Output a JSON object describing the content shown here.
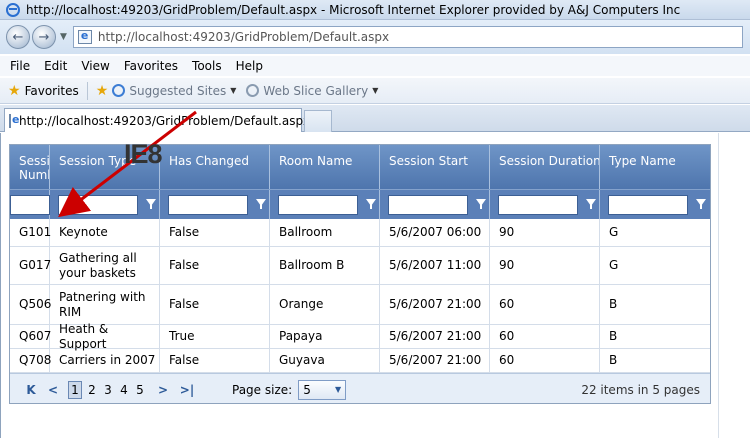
{
  "window": {
    "title": "http://localhost:49203/GridProblem/Default.aspx - Microsoft Internet Explorer provided by A&J Computers Inc"
  },
  "address_bar": {
    "url": "http://localhost:49203/GridProblem/Default.aspx"
  },
  "menu": {
    "items": [
      "File",
      "Edit",
      "View",
      "Favorites",
      "Tools",
      "Help"
    ]
  },
  "favorites_bar": {
    "favorites_label": "Favorites",
    "suggested_sites": "Suggested Sites",
    "web_slice_gallery": "Web Slice Gallery"
  },
  "tab": {
    "label": "http://localhost:49203/GridProblem/Default.aspx"
  },
  "grid": {
    "columns": [
      "Session Number",
      "Session Type",
      "Has Changed",
      "Room Name",
      "Session Start",
      "Session Duration",
      "Type Name"
    ],
    "rows": [
      [
        "G101",
        "Keynote",
        "False",
        "Ballroom",
        "5/6/2007 06:00",
        "90",
        "G"
      ],
      [
        "G017",
        "Gathering all your baskets",
        "False",
        "Ballroom B",
        "5/6/2007 11:00",
        "90",
        "G"
      ],
      [
        "Q506",
        "Patnering with RIM",
        "False",
        "Orange",
        "5/6/2007 21:00",
        "60",
        "B"
      ],
      [
        "Q607",
        "Heath & Support",
        "True",
        "Papaya",
        "5/6/2007 21:00",
        "60",
        "B"
      ],
      [
        "Q708",
        "Carriers in 2007",
        "False",
        "Guyava",
        "5/6/2007 21:00",
        "60",
        "B"
      ]
    ],
    "pager": {
      "first": "K",
      "prev": "<",
      "pages": [
        "1",
        "2",
        "3",
        "4",
        "5"
      ],
      "current_page": "1",
      "next": ">",
      "last": ">|",
      "page_size_label": "Page size:",
      "page_size_value": "5",
      "items_info": "22 items in 5 pages"
    }
  },
  "annotation": {
    "label": "IE8",
    "arrow_color": "#cc0000"
  }
}
